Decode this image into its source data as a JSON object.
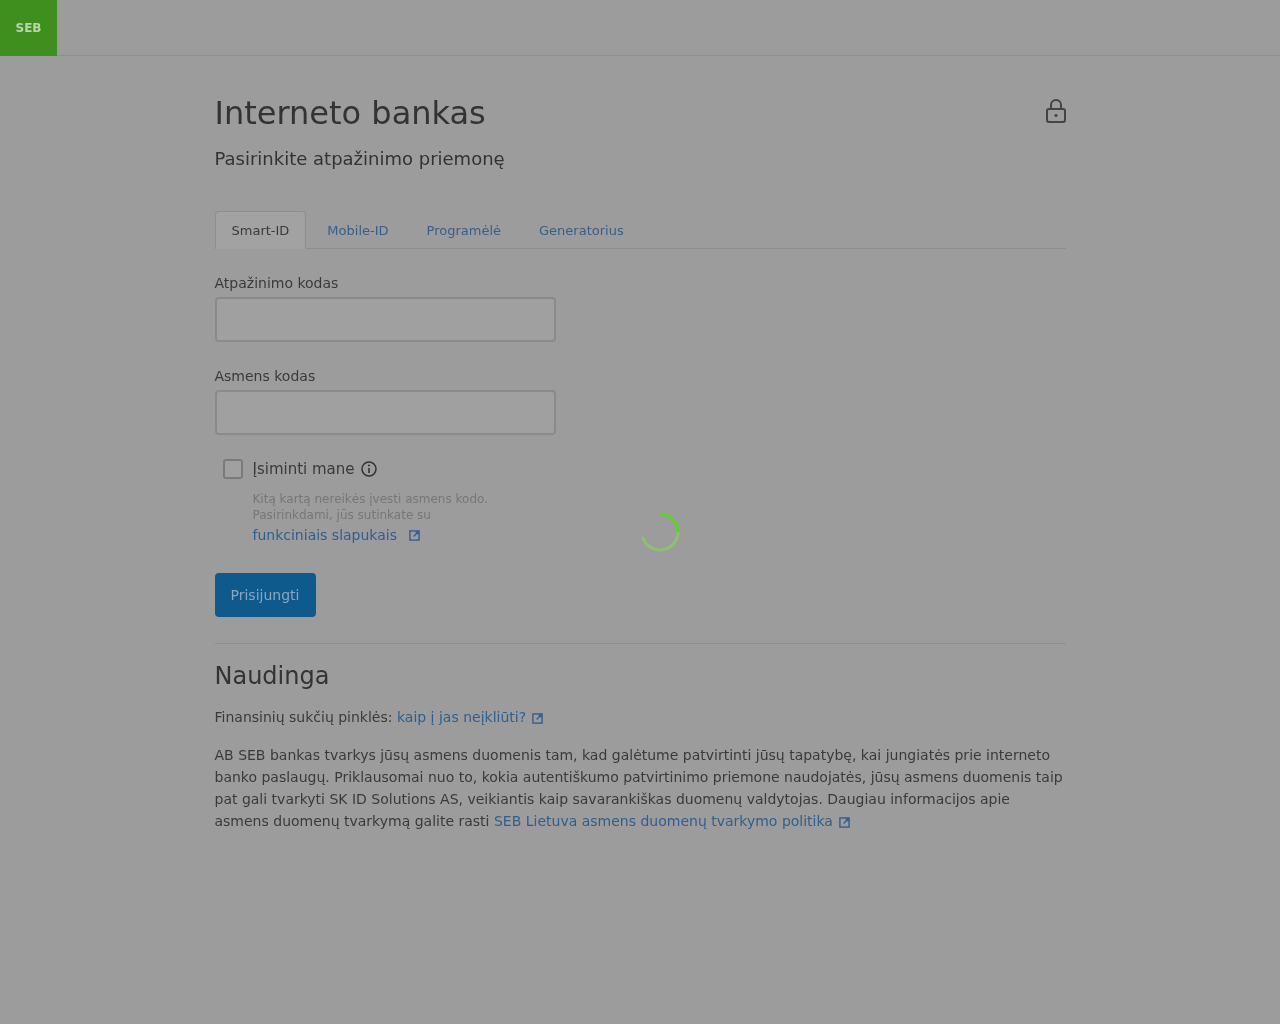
{
  "header": {
    "logo": "SEB"
  },
  "page": {
    "title": "Interneto bankas",
    "subtitle": "Pasirinkite atpažinimo priemonę"
  },
  "tabs": [
    {
      "label": "Smart-ID",
      "selected": true
    },
    {
      "label": "Mobile-ID",
      "selected": false
    },
    {
      "label": "Programėlė",
      "selected": false
    },
    {
      "label": "Generatorius",
      "selected": false
    }
  ],
  "form": {
    "fields": [
      {
        "label": "Atpažinimo kodas"
      },
      {
        "label": "Asmens kodas"
      }
    ],
    "remember": {
      "label": "Įsiminti mane",
      "checked": false,
      "hint": "Kitą kartą nereikės įvesti asmens kodo. Pasirinkdami, jūs sutinkate su",
      "link": "funkciniais slapukais"
    },
    "submit": "Prisijungti"
  },
  "useful": {
    "title": "Naudinga",
    "fraud": {
      "text": "Finansinių sukčių pinklės: ",
      "link": "kaip į jas neįkliūti?"
    },
    "privacy": {
      "text": "AB SEB bankas tvarkys jūsų asmens duomenis tam, kad galėtume patvirtinti jūsų tapatybę, kai jungiatės prie interneto banko paslaugų. Priklausomai nuo to, kokia autentiškumo patvirtinimo priemone naudojatės, jūsų asmens duomenis taip pat gali tvarkyti SK ID Solutions AS, veikiantis kaip savarankiškas duomenų valdytojas. Daugiau informacijos apie asmens duomenų tvarkymą galite rasti ",
      "link": "SEB Lietuva asmens duomenų tvarkymo politika"
    }
  },
  "loading": {
    "visible": true
  }
}
